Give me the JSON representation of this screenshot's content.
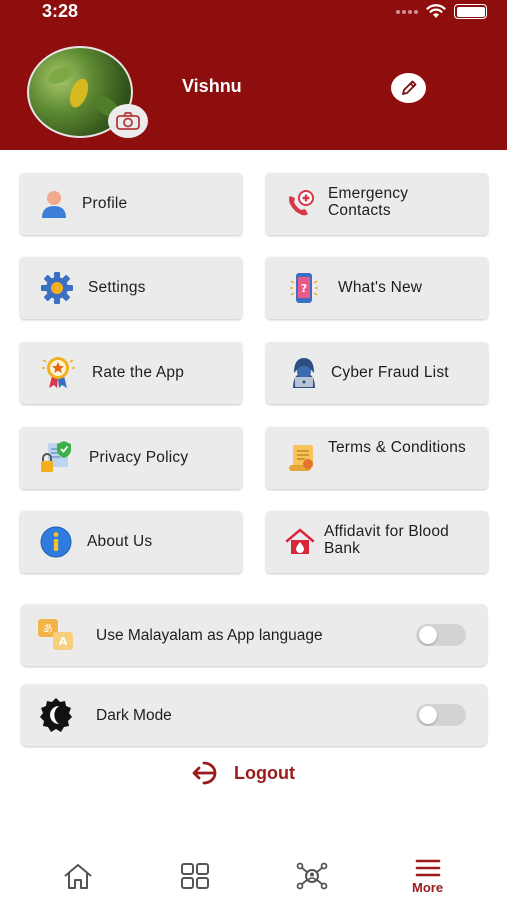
{
  "status_bar": {
    "time": "3:28"
  },
  "profile": {
    "name": "Vishnu"
  },
  "menu": {
    "profile": "Profile",
    "emergency_contacts": "Emergency Contacts",
    "settings": "Settings",
    "whats_new": "What's New",
    "rate_app": "Rate the App",
    "cyber_fraud": "Cyber Fraud List",
    "privacy_policy": "Privacy Policy",
    "terms": "Terms & Conditions",
    "about_us": "About Us",
    "affidavit": "Affidavit for Blood Bank"
  },
  "toggles": {
    "malayalam": {
      "label": "Use Malayalam as App language",
      "on": false
    },
    "dark_mode": {
      "label": "Dark Mode",
      "on": false
    }
  },
  "logout": {
    "label": "Logout"
  },
  "tabbar": {
    "home_icon": "home-icon",
    "grid_icon": "grid-icon",
    "network_icon": "network-icon",
    "more_label": "More"
  },
  "colors": {
    "header": "#8e0d0d",
    "accent": "#9a1b1b",
    "card": "#ebebeb"
  }
}
